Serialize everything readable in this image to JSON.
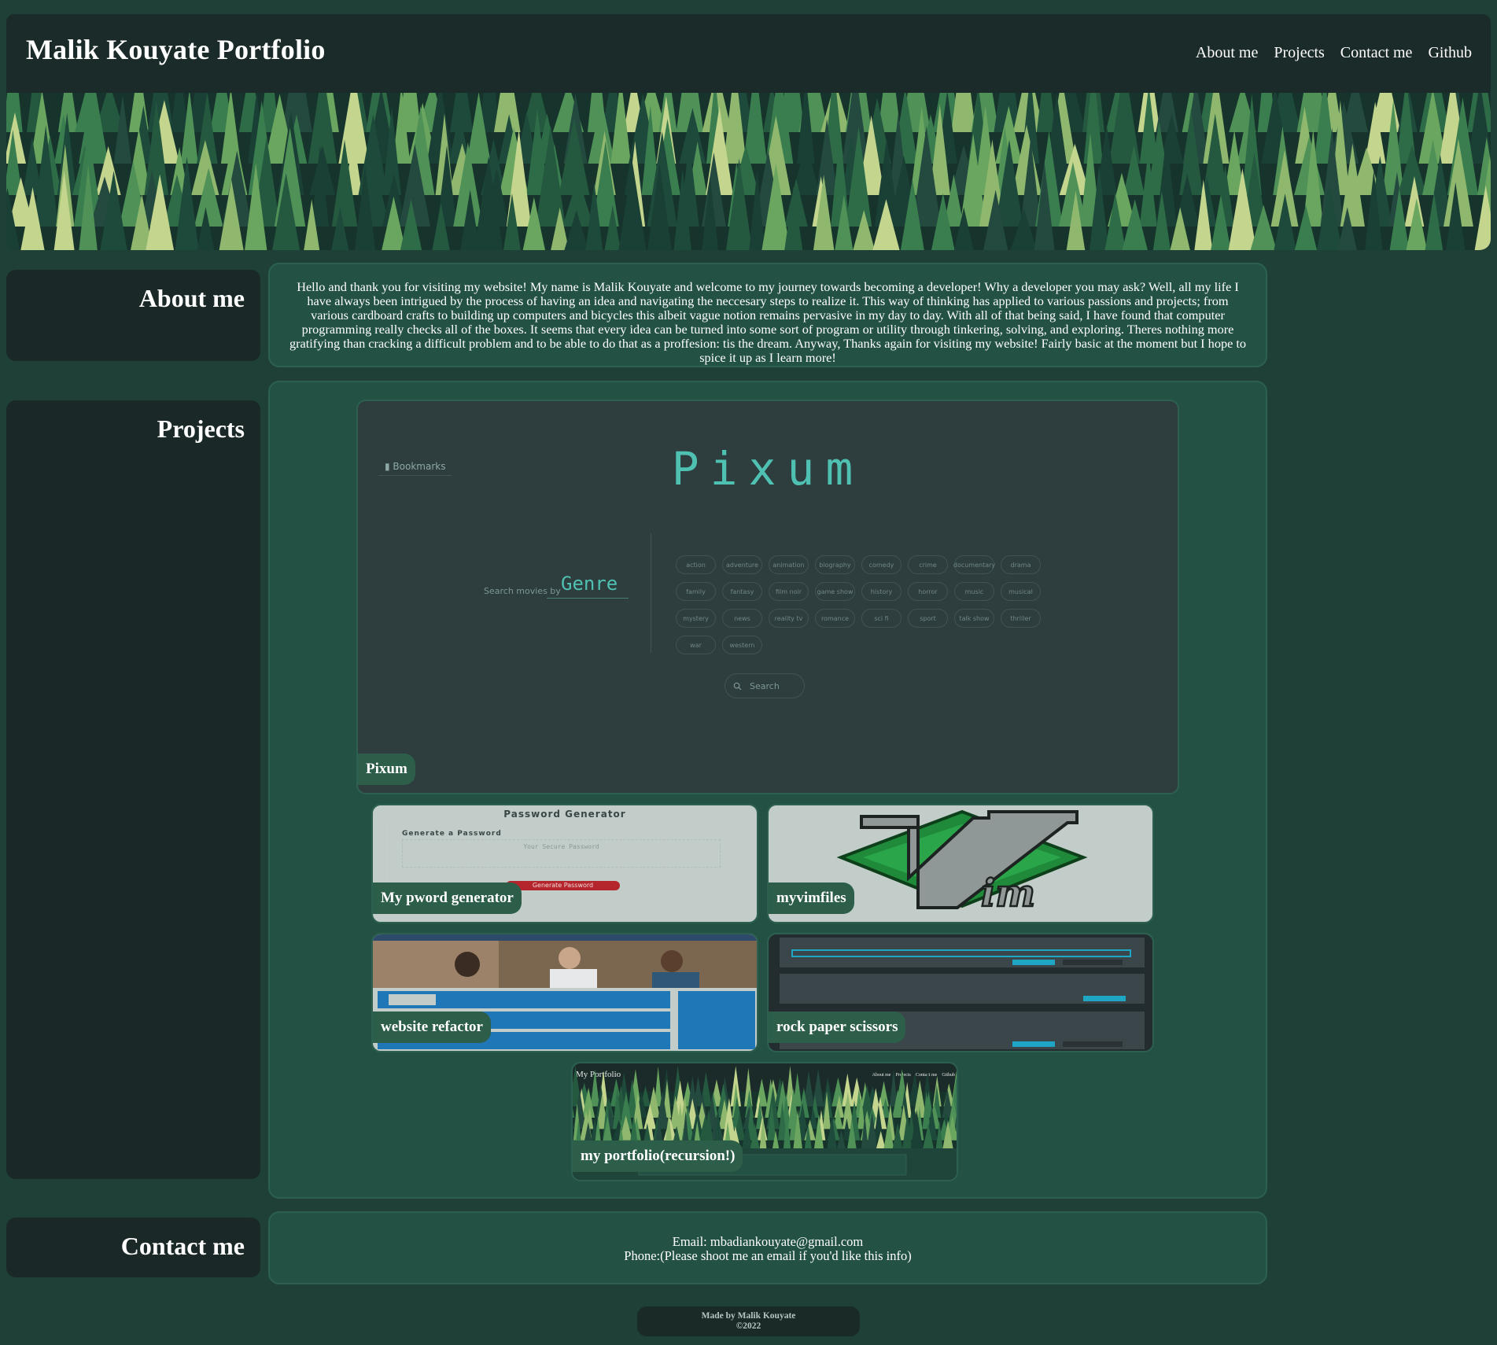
{
  "header": {
    "title": "Malik Kouyate Portfolio",
    "nav": [
      "About me",
      "Projects",
      "Contact me",
      "Github"
    ]
  },
  "colors": {
    "page_background": "#1e4037",
    "header_background": "#1b2b29",
    "panel_background": "#235245",
    "label_background": "#2c5e49",
    "accent": "#4fc1b2"
  },
  "about": {
    "heading": "About me",
    "text": "Hello and thank you for visiting my website! My name is Malik Kouyate and welcome to my journey towards becoming a developer! Why a developer you may ask? Well, all my life I have always been intrigued by the process of having an idea and navigating the neccesary steps to realize it. This way of thinking has applied to various passions and projects; from various cardboard crafts to building up computers and bicycles this albeit vague notion remains pervasive in my day to day. With all of that being said, I have found that computer programming really checks all of the boxes. It seems that every idea can be turned into some sort of program or utility through tinkering, solving, and exploring. Theres nothing more gratifying than cracking a difficult problem and to be able to do that as a proffesion: tis the dream. Anyway, Thanks again for visiting my website! Fairly basic at the moment but I hope to spice it up as I learn more!"
  },
  "projects": {
    "heading": "Projects",
    "items": [
      {
        "label": "Pixum"
      },
      {
        "label": "My pword generator"
      },
      {
        "label": "myvimfiles"
      },
      {
        "label": "website refactor"
      },
      {
        "label": "rock paper scissors"
      },
      {
        "label": "my portfolio(recursion!)"
      }
    ],
    "pixum_preview": {
      "bookmarks": "Bookmarks",
      "title": "Pixum",
      "search_by": "Search movies by",
      "search_mode": "Genre",
      "genres": [
        "action",
        "adventure",
        "animation",
        "biography",
        "comedy",
        "crime",
        "documentary",
        "drama",
        "family",
        "fantasy",
        "film noir",
        "game show",
        "history",
        "horror",
        "music",
        "musical",
        "mystery",
        "news",
        "reality tv",
        "romance",
        "sci fi",
        "sport",
        "talk show",
        "thriller",
        "war",
        "western"
      ],
      "search_placeholder": "Search"
    },
    "pword_preview": {
      "title": "Password Generator",
      "subtitle": "Generate a Password",
      "placeholder": "Your Secure Password",
      "button": "Generate Password"
    },
    "portfolio_preview": {
      "title": "My Portfolio",
      "nav": [
        "About me",
        "Projects",
        "Contact me",
        "Github"
      ]
    }
  },
  "contact": {
    "heading": "Contact me",
    "email": "Email: mbadiankouyate@gmail.com",
    "phone": "Phone:(Please shoot me an email if you'd like this info)"
  },
  "footer": {
    "line1": "Made by Malik Kouyate",
    "line2": "©2022"
  }
}
